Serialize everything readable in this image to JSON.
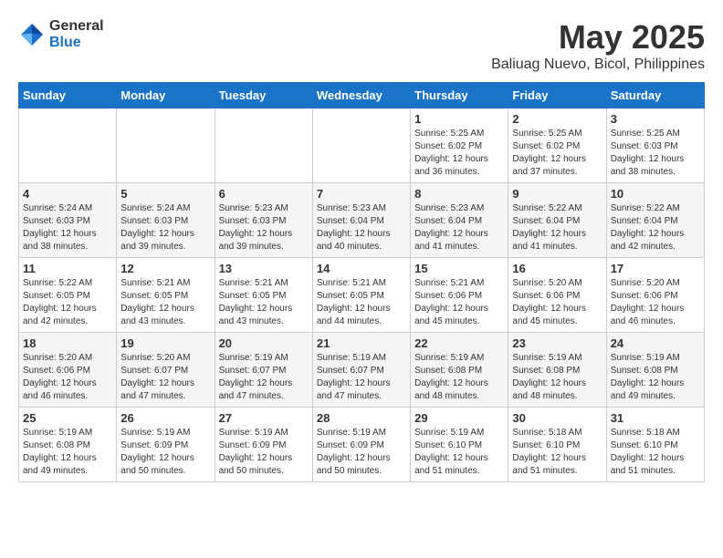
{
  "header": {
    "logo_general": "General",
    "logo_blue": "Blue",
    "month_title": "May 2025",
    "location": "Baliuag Nuevo, Bicol, Philippines"
  },
  "days_of_week": [
    "Sunday",
    "Monday",
    "Tuesday",
    "Wednesday",
    "Thursday",
    "Friday",
    "Saturday"
  ],
  "weeks": [
    [
      {
        "day": "",
        "info": ""
      },
      {
        "day": "",
        "info": ""
      },
      {
        "day": "",
        "info": ""
      },
      {
        "day": "",
        "info": ""
      },
      {
        "day": "1",
        "info": "Sunrise: 5:25 AM\nSunset: 6:02 PM\nDaylight: 12 hours\nand 36 minutes."
      },
      {
        "day": "2",
        "info": "Sunrise: 5:25 AM\nSunset: 6:02 PM\nDaylight: 12 hours\nand 37 minutes."
      },
      {
        "day": "3",
        "info": "Sunrise: 5:25 AM\nSunset: 6:03 PM\nDaylight: 12 hours\nand 38 minutes."
      }
    ],
    [
      {
        "day": "4",
        "info": "Sunrise: 5:24 AM\nSunset: 6:03 PM\nDaylight: 12 hours\nand 38 minutes."
      },
      {
        "day": "5",
        "info": "Sunrise: 5:24 AM\nSunset: 6:03 PM\nDaylight: 12 hours\nand 39 minutes."
      },
      {
        "day": "6",
        "info": "Sunrise: 5:23 AM\nSunset: 6:03 PM\nDaylight: 12 hours\nand 39 minutes."
      },
      {
        "day": "7",
        "info": "Sunrise: 5:23 AM\nSunset: 6:04 PM\nDaylight: 12 hours\nand 40 minutes."
      },
      {
        "day": "8",
        "info": "Sunrise: 5:23 AM\nSunset: 6:04 PM\nDaylight: 12 hours\nand 41 minutes."
      },
      {
        "day": "9",
        "info": "Sunrise: 5:22 AM\nSunset: 6:04 PM\nDaylight: 12 hours\nand 41 minutes."
      },
      {
        "day": "10",
        "info": "Sunrise: 5:22 AM\nSunset: 6:04 PM\nDaylight: 12 hours\nand 42 minutes."
      }
    ],
    [
      {
        "day": "11",
        "info": "Sunrise: 5:22 AM\nSunset: 6:05 PM\nDaylight: 12 hours\nand 42 minutes."
      },
      {
        "day": "12",
        "info": "Sunrise: 5:21 AM\nSunset: 6:05 PM\nDaylight: 12 hours\nand 43 minutes."
      },
      {
        "day": "13",
        "info": "Sunrise: 5:21 AM\nSunset: 6:05 PM\nDaylight: 12 hours\nand 43 minutes."
      },
      {
        "day": "14",
        "info": "Sunrise: 5:21 AM\nSunset: 6:05 PM\nDaylight: 12 hours\nand 44 minutes."
      },
      {
        "day": "15",
        "info": "Sunrise: 5:21 AM\nSunset: 6:06 PM\nDaylight: 12 hours\nand 45 minutes."
      },
      {
        "day": "16",
        "info": "Sunrise: 5:20 AM\nSunset: 6:06 PM\nDaylight: 12 hours\nand 45 minutes."
      },
      {
        "day": "17",
        "info": "Sunrise: 5:20 AM\nSunset: 6:06 PM\nDaylight: 12 hours\nand 46 minutes."
      }
    ],
    [
      {
        "day": "18",
        "info": "Sunrise: 5:20 AM\nSunset: 6:06 PM\nDaylight: 12 hours\nand 46 minutes."
      },
      {
        "day": "19",
        "info": "Sunrise: 5:20 AM\nSunset: 6:07 PM\nDaylight: 12 hours\nand 47 minutes."
      },
      {
        "day": "20",
        "info": "Sunrise: 5:19 AM\nSunset: 6:07 PM\nDaylight: 12 hours\nand 47 minutes."
      },
      {
        "day": "21",
        "info": "Sunrise: 5:19 AM\nSunset: 6:07 PM\nDaylight: 12 hours\nand 47 minutes."
      },
      {
        "day": "22",
        "info": "Sunrise: 5:19 AM\nSunset: 6:08 PM\nDaylight: 12 hours\nand 48 minutes."
      },
      {
        "day": "23",
        "info": "Sunrise: 5:19 AM\nSunset: 6:08 PM\nDaylight: 12 hours\nand 48 minutes."
      },
      {
        "day": "24",
        "info": "Sunrise: 5:19 AM\nSunset: 6:08 PM\nDaylight: 12 hours\nand 49 minutes."
      }
    ],
    [
      {
        "day": "25",
        "info": "Sunrise: 5:19 AM\nSunset: 6:08 PM\nDaylight: 12 hours\nand 49 minutes."
      },
      {
        "day": "26",
        "info": "Sunrise: 5:19 AM\nSunset: 6:09 PM\nDaylight: 12 hours\nand 50 minutes."
      },
      {
        "day": "27",
        "info": "Sunrise: 5:19 AM\nSunset: 6:09 PM\nDaylight: 12 hours\nand 50 minutes."
      },
      {
        "day": "28",
        "info": "Sunrise: 5:19 AM\nSunset: 6:09 PM\nDaylight: 12 hours\nand 50 minutes."
      },
      {
        "day": "29",
        "info": "Sunrise: 5:19 AM\nSunset: 6:10 PM\nDaylight: 12 hours\nand 51 minutes."
      },
      {
        "day": "30",
        "info": "Sunrise: 5:18 AM\nSunset: 6:10 PM\nDaylight: 12 hours\nand 51 minutes."
      },
      {
        "day": "31",
        "info": "Sunrise: 5:18 AM\nSunset: 6:10 PM\nDaylight: 12 hours\nand 51 minutes."
      }
    ]
  ]
}
